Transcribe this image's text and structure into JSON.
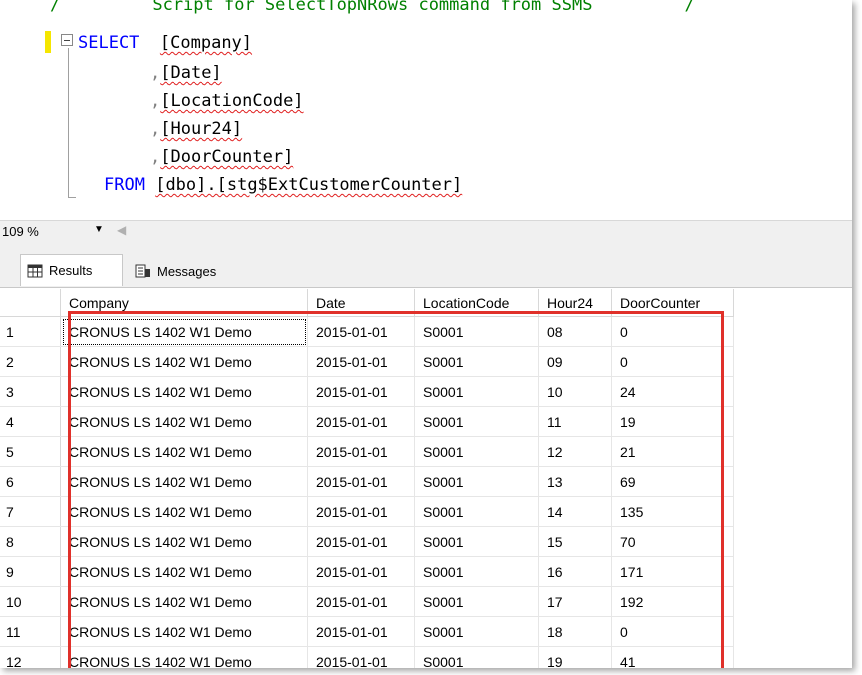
{
  "editor": {
    "comment_line": "/         Script for SelectTopNRows command from SSMS         /",
    "lines": [
      {
        "kw": "SELECT",
        "id": "[Company]"
      },
      {
        "prefix": ",",
        "id": "[Date]"
      },
      {
        "prefix": ",",
        "id": "[LocationCode]"
      },
      {
        "prefix": ",",
        "id": "[Hour24]"
      },
      {
        "prefix": ",",
        "id": "[DoorCounter]"
      },
      {
        "kw": "FROM",
        "id": "[dbo].[stg$ExtCustomerCounter]"
      }
    ]
  },
  "zoom": {
    "value": "109 %",
    "dropdown_icon": "chevron-down-icon"
  },
  "tabs": [
    {
      "label": "Results",
      "icon": "grid-icon"
    },
    {
      "label": "Messages",
      "icon": "messages-icon"
    }
  ],
  "grid": {
    "columns": [
      "",
      "Company",
      "Date",
      "LocationCode",
      "Hour24",
      "DoorCounter"
    ],
    "rows": [
      [
        "1",
        "CRONUS LS 1402 W1 Demo",
        "2015-01-01",
        "S0001",
        "08",
        "0"
      ],
      [
        "2",
        "CRONUS LS 1402 W1 Demo",
        "2015-01-01",
        "S0001",
        "09",
        "0"
      ],
      [
        "3",
        "CRONUS LS 1402 W1 Demo",
        "2015-01-01",
        "S0001",
        "10",
        "24"
      ],
      [
        "4",
        "CRONUS LS 1402 W1 Demo",
        "2015-01-01",
        "S0001",
        "11",
        "19"
      ],
      [
        "5",
        "CRONUS LS 1402 W1 Demo",
        "2015-01-01",
        "S0001",
        "12",
        "21"
      ],
      [
        "6",
        "CRONUS LS 1402 W1 Demo",
        "2015-01-01",
        "S0001",
        "13",
        "69"
      ],
      [
        "7",
        "CRONUS LS 1402 W1 Demo",
        "2015-01-01",
        "S0001",
        "14",
        "135"
      ],
      [
        "8",
        "CRONUS LS 1402 W1 Demo",
        "2015-01-01",
        "S0001",
        "15",
        "70"
      ],
      [
        "9",
        "CRONUS LS 1402 W1 Demo",
        "2015-01-01",
        "S0001",
        "16",
        "171"
      ],
      [
        "10",
        "CRONUS LS 1402 W1 Demo",
        "2015-01-01",
        "S0001",
        "17",
        "192"
      ],
      [
        "11",
        "CRONUS LS 1402 W1 Demo",
        "2015-01-01",
        "S0001",
        "18",
        "0"
      ],
      [
        "12",
        "CRONUS LS 1402 W1 Demo",
        "2015-01-01",
        "S0001",
        "19",
        "41"
      ]
    ]
  },
  "colors": {
    "highlight": "#e0302a",
    "keyword": "#0000ff",
    "comment": "#008000"
  }
}
